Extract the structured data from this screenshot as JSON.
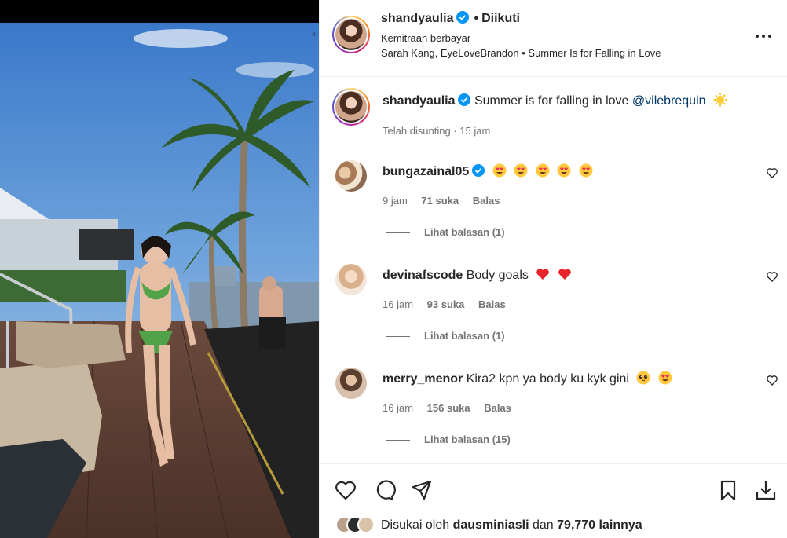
{
  "post": {
    "username": "shandyaulia",
    "follow_status": "Diikuti",
    "separator": "•",
    "paid_partnership": "Kemitraan berbayar",
    "audio": "Sarah Kang, EyeLoveBrandon • Summer Is for Falling in Love"
  },
  "caption": {
    "username": "shandyaulia",
    "text": "Summer is for falling in love",
    "mention": "@vilebrequin",
    "emoji": "sun",
    "meta": "Telah disunting · 15 jam"
  },
  "comments": [
    {
      "username": "bungazainal05",
      "verified": true,
      "text": "",
      "emojis": [
        "heart-eyes",
        "heart-eyes",
        "heart-eyes",
        "heart-eyes",
        "heart-eyes"
      ],
      "time": "9 jam",
      "likes": "71 suka",
      "reply": "Balas",
      "view_replies": "Lihat balasan (1)"
    },
    {
      "username": "devinafscode",
      "verified": false,
      "text": "Body goals",
      "emojis": [
        "red-heart",
        "red-heart"
      ],
      "time": "16 jam",
      "likes": "93 suka",
      "reply": "Balas",
      "view_replies": "Lihat balasan (1)"
    },
    {
      "username": "merry_menor",
      "verified": false,
      "text": "Kira2 kpn ya body ku kyk gini",
      "emojis": [
        "pleading-face",
        "heart-eyes"
      ],
      "time": "16 jam",
      "likes": "156 suka",
      "reply": "Balas",
      "view_replies": "Lihat balasan (15)"
    }
  ],
  "likes": {
    "prefix": "Disukai oleh",
    "user": "dausminiasli",
    "middle": "dan",
    "count": "79,770 lainnya"
  },
  "icons": [
    "more-icon",
    "heart-icon",
    "comment-icon",
    "share-icon",
    "bookmark-icon",
    "download-icon",
    "verified-icon"
  ],
  "colors": {
    "verified": "#0095f6",
    "link": "#00376b",
    "muted": "#737373",
    "text": "#262626"
  }
}
